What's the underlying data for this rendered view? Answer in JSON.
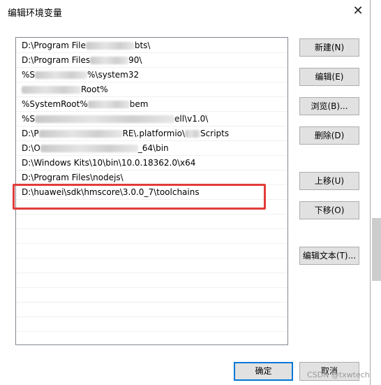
{
  "window": {
    "title": "编辑环境变量",
    "close_glyph": "✕"
  },
  "paths": [
    {
      "pre": "D:\\Program File",
      "mid": true,
      "post": "bts\\"
    },
    {
      "pre": "D:\\Program Files",
      "mid": true,
      "post": "90\\"
    },
    {
      "pre": "%S",
      "mid": true,
      "post": "%\\system32"
    },
    {
      "pre": "",
      "mid": true,
      "post": "Root%"
    },
    {
      "pre": "%SystemRoot%",
      "mid": true,
      "post": "bem"
    },
    {
      "pre": "%S",
      "mid": true,
      "post": "ell\\v1.0\\"
    },
    {
      "pre": "D:\\P",
      "mid": true,
      "post": "RE\\.platformio\\",
      "mid2": true,
      "post2": "Scripts"
    },
    {
      "pre": "D:\\O",
      "mid": true,
      "post": "_64\\bin"
    },
    {
      "pre": "D:\\Windows Kits\\10\\bin\\10.0.18362.0\\x64",
      "mid": false,
      "post": ""
    },
    {
      "pre": "D:\\Program Files\\nodejs\\",
      "mid": false,
      "post": ""
    },
    {
      "pre": "D:\\huawei\\sdk\\hmscore\\3.0.0_7\\toolchains",
      "mid": false,
      "post": ""
    }
  ],
  "buttons": {
    "new": "新建(N)",
    "edit": "编辑(E)",
    "browse": "浏览(B)...",
    "delete": "删除(D)",
    "move_up": "上移(U)",
    "move_down": "下移(O)",
    "edit_text": "编辑文本(T)...",
    "ok": "确定",
    "cancel": "取消"
  },
  "watermark": "CSDN @txwtech",
  "colors": {
    "highlight_box": "#e23b3b",
    "default_button_border": "#0078d7"
  }
}
